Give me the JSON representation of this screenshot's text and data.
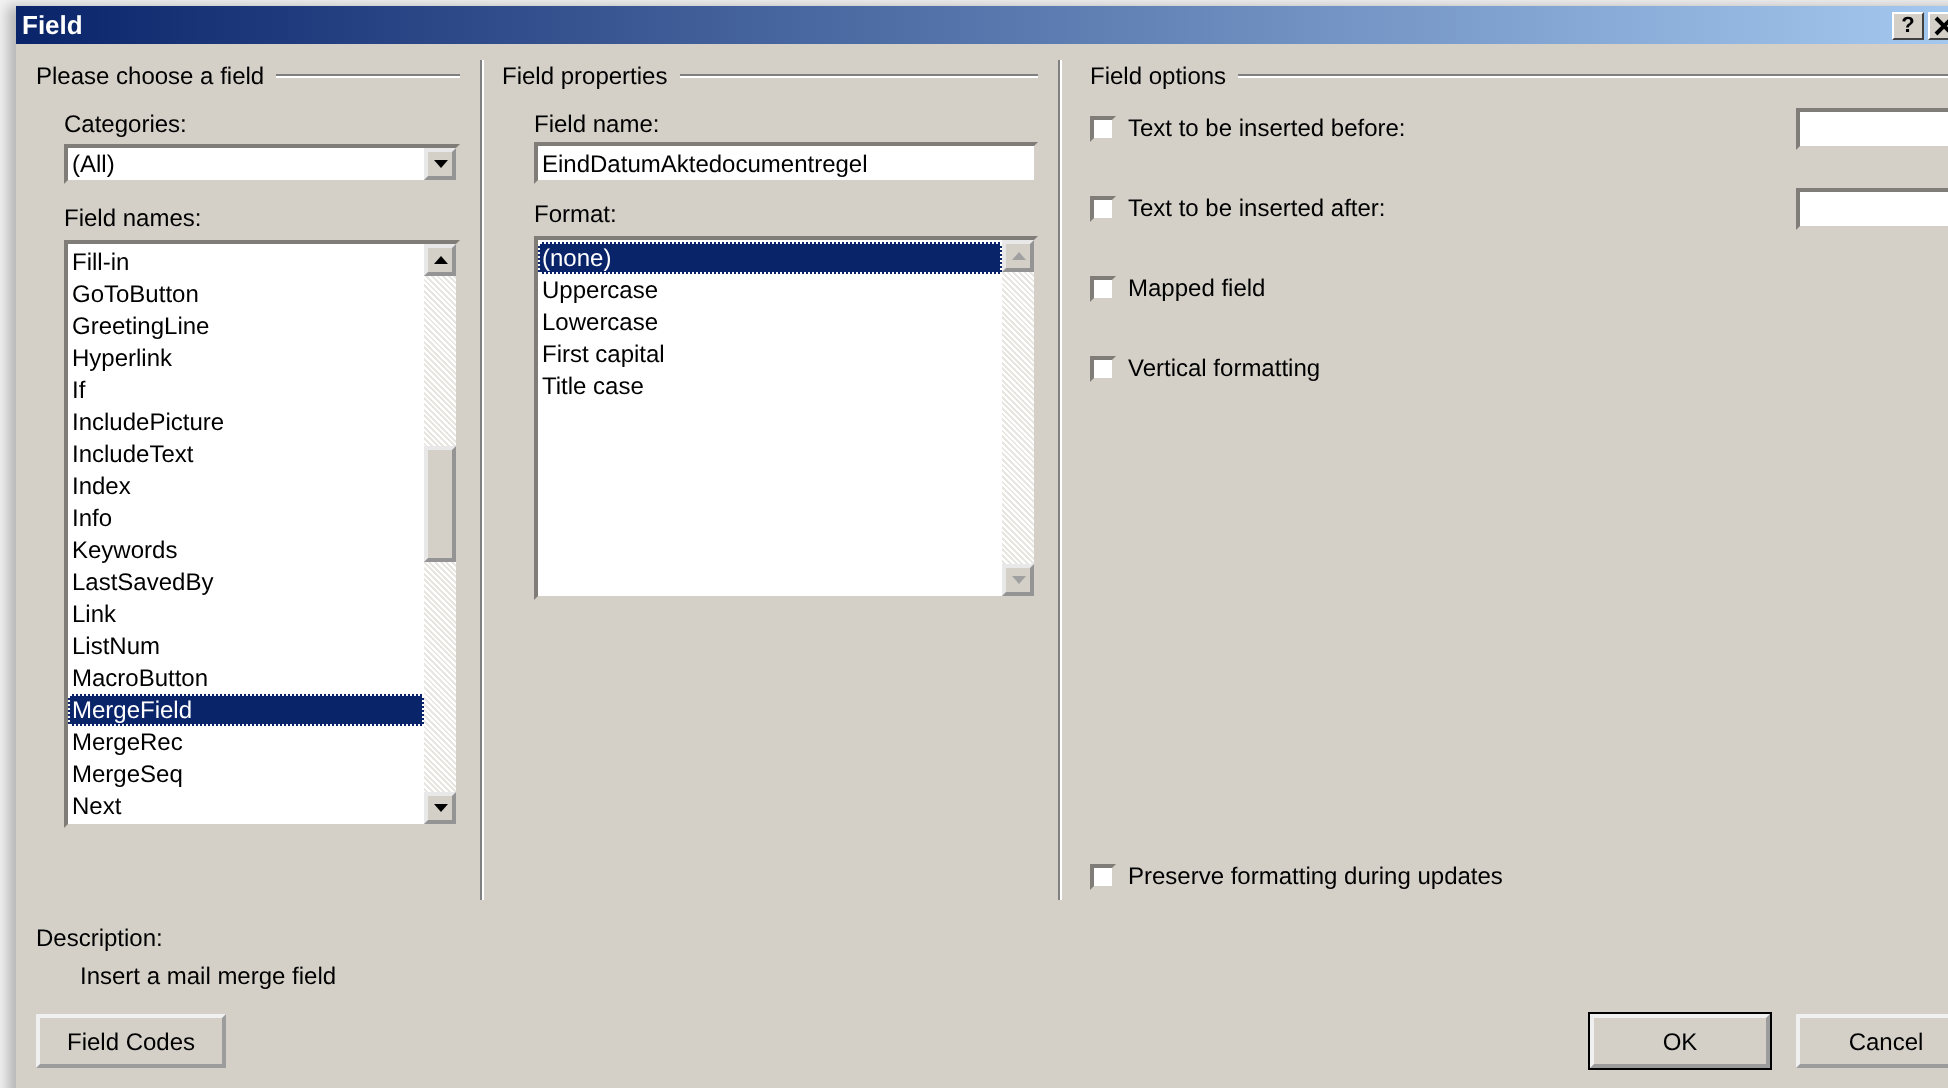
{
  "window": {
    "title": "Field",
    "help": "?"
  },
  "choose": {
    "heading": "Please choose a field",
    "categories_label": "Categories:",
    "categories_value": "(All)",
    "field_names_label": "Field names:",
    "field_names": [
      {
        "label": "Fill-in",
        "selected": false
      },
      {
        "label": "GoToButton",
        "selected": false
      },
      {
        "label": "GreetingLine",
        "selected": false
      },
      {
        "label": "Hyperlink",
        "selected": false
      },
      {
        "label": "If",
        "selected": false
      },
      {
        "label": "IncludePicture",
        "selected": false
      },
      {
        "label": "IncludeText",
        "selected": false
      },
      {
        "label": "Index",
        "selected": false
      },
      {
        "label": "Info",
        "selected": false
      },
      {
        "label": "Keywords",
        "selected": false
      },
      {
        "label": "LastSavedBy",
        "selected": false
      },
      {
        "label": "Link",
        "selected": false
      },
      {
        "label": "ListNum",
        "selected": false
      },
      {
        "label": "MacroButton",
        "selected": false
      },
      {
        "label": "MergeField",
        "selected": true
      },
      {
        "label": "MergeRec",
        "selected": false
      },
      {
        "label": "MergeSeq",
        "selected": false
      },
      {
        "label": "Next",
        "selected": false
      }
    ]
  },
  "properties": {
    "heading": "Field properties",
    "field_name_label": "Field name:",
    "field_name_value": "EindDatumAktedocumentregel",
    "format_label": "Format:",
    "formats": [
      {
        "label": "(none)",
        "selected": true
      },
      {
        "label": "Uppercase",
        "selected": false
      },
      {
        "label": "Lowercase",
        "selected": false
      },
      {
        "label": "First capital",
        "selected": false
      },
      {
        "label": "Title case",
        "selected": false
      }
    ]
  },
  "options": {
    "heading": "Field options",
    "items": [
      {
        "label": "Text to be inserted before:",
        "checked": false,
        "kind": "with_field"
      },
      {
        "label": "Text to be inserted after:",
        "checked": false,
        "kind": "with_field"
      },
      {
        "label": "Mapped field",
        "checked": false,
        "kind": "plain"
      },
      {
        "label": "Vertical formatting",
        "checked": false,
        "kind": "plain"
      }
    ],
    "preserve": {
      "label": "Preserve formatting during updates",
      "checked": false
    }
  },
  "description": {
    "label": "Description:",
    "text": "Insert a mail merge field"
  },
  "buttons": {
    "field_codes": "Field Codes",
    "ok": "OK",
    "cancel": "Cancel"
  }
}
